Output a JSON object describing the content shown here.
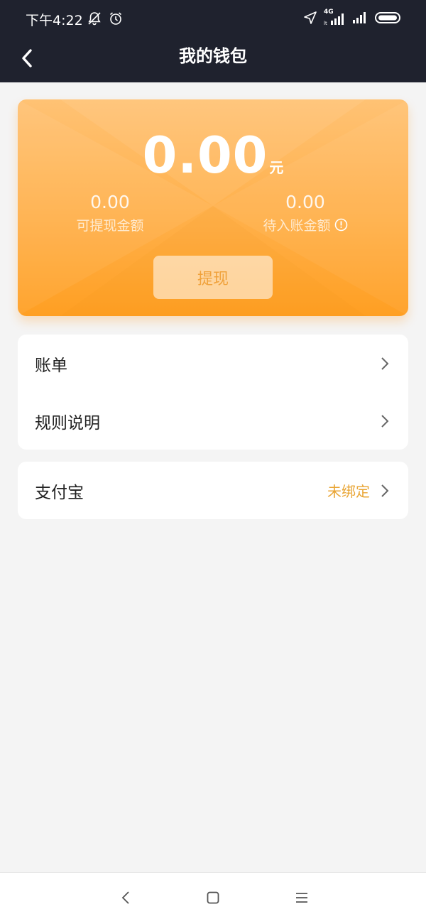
{
  "status_bar": {
    "time": "下午4:22",
    "left_icons": [
      "bell-muted-icon",
      "alarm-icon"
    ],
    "right_icons": [
      "location-arrow-icon",
      "signal-4g-icon",
      "signal-icon",
      "battery-icon"
    ],
    "network_label": "4G"
  },
  "header": {
    "title": "我的钱包",
    "back_icon": "back-arrow-icon"
  },
  "wallet": {
    "balance": "0.00",
    "unit": "元",
    "withdrawable_value": "0.00",
    "withdrawable_label": "可提现金额",
    "pending_value": "0.00",
    "pending_label": "待入账金额",
    "withdraw_label": "提现",
    "accent_color": "#ffb04a"
  },
  "menu": {
    "items": [
      {
        "label": "账单"
      },
      {
        "label": "规则说明"
      }
    ]
  },
  "payment": {
    "label": "支付宝",
    "status": "未绑定",
    "status_color": "#e9a534"
  },
  "system_nav": [
    "back-icon",
    "home-icon",
    "menu-icon"
  ]
}
